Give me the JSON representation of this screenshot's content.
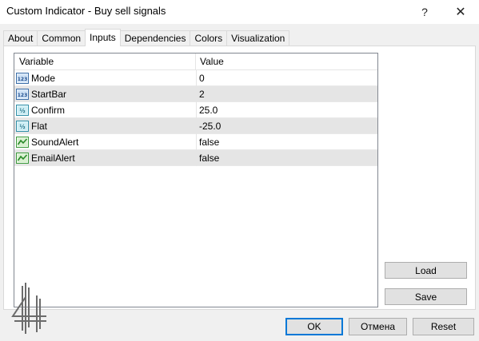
{
  "window": {
    "title": "Custom Indicator - Buy sell signals",
    "help_glyph": "?",
    "close_glyph": "✕"
  },
  "tabs": [
    {
      "label": "About",
      "active": false
    },
    {
      "label": "Common",
      "active": false
    },
    {
      "label": "Inputs",
      "active": true
    },
    {
      "label": "Dependencies",
      "active": false
    },
    {
      "label": "Colors",
      "active": false
    },
    {
      "label": "Visualization",
      "active": false
    }
  ],
  "grid": {
    "columns": {
      "variable": "Variable",
      "value": "Value"
    },
    "rows": [
      {
        "icon": "integer-icon",
        "name": "Mode",
        "value": "0"
      },
      {
        "icon": "integer-icon",
        "name": "StartBar",
        "value": "2"
      },
      {
        "icon": "double-icon",
        "name": "Confirm",
        "value": "25.0"
      },
      {
        "icon": "double-icon",
        "name": "Flat",
        "value": "-25.0"
      },
      {
        "icon": "boolean-icon",
        "name": "SoundAlert",
        "value": "false"
      },
      {
        "icon": "boolean-icon",
        "name": "EmailAlert",
        "value": "false"
      }
    ]
  },
  "side_buttons": {
    "load": "Load",
    "save": "Save"
  },
  "buttons": {
    "ok": "OK",
    "cancel": "Отмена",
    "reset": "Reset"
  },
  "colors": {
    "accent": "#0078d7",
    "alt_row": "#e5e5e5",
    "dialog_bg": "#f0f0f0"
  }
}
